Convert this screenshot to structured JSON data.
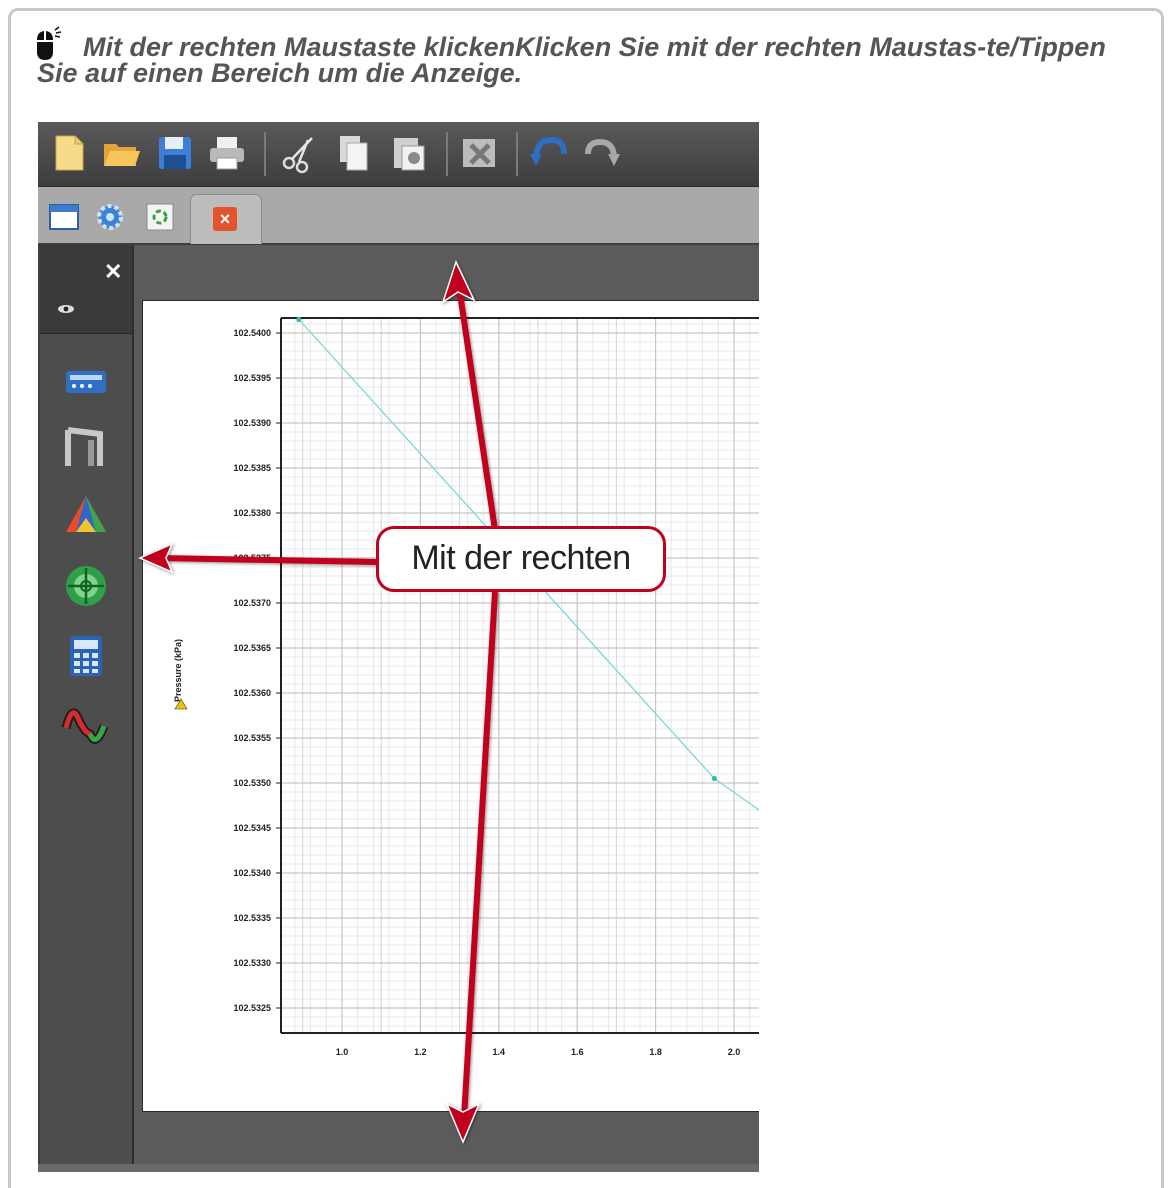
{
  "caption": {
    "text": "Mit der rechten Maustaste klickenKlicken Sie mit der rechten Maustas-te/Tippen Sie auf einen Bereich um die Anzeige.",
    "icon": "mouse-icon"
  },
  "toolbar": {
    "buttons": [
      "new-document-icon",
      "open-folder-icon",
      "save-icon",
      "print-icon",
      "cut-icon",
      "copy-icon",
      "paste-icon",
      "delete-icon",
      "undo-icon",
      "redo-icon"
    ]
  },
  "tabs": {
    "icons": [
      "window-icon",
      "gear-icon",
      "sync-icon"
    ],
    "active_close": "×"
  },
  "sidebar": {
    "close_label": "✕",
    "icons": [
      "device-icon",
      "bridge-icon",
      "triangle-prism-icon",
      "target-icon",
      "calculator-icon",
      "waveform-icon"
    ]
  },
  "chart_data": {
    "type": "line",
    "ylabel": "Pressure (kPa)",
    "xlabel": "",
    "x_ticks": [
      "1.0",
      "1.2",
      "1.4",
      "1.6",
      "1.8",
      "2.0"
    ],
    "y_ticks": [
      "102.5400",
      "102.5395",
      "102.5390",
      "102.5385",
      "102.5380",
      "102.5375",
      "102.5370",
      "102.5365",
      "102.5360",
      "102.5355",
      "102.5350",
      "102.5345",
      "102.5340",
      "102.5335",
      "102.5330",
      "102.5325"
    ],
    "xlim": [
      0.88,
      2.08
    ],
    "ylim": [
      102.5322,
      102.5403
    ],
    "series": [
      {
        "values_x": [
          0.89,
          1.95,
          2.08
        ],
        "values_y": [
          102.54015,
          102.53505,
          102.53465
        ],
        "markers": [
          0.89,
          1.95
        ],
        "color": "#7fd6d6"
      }
    ],
    "grid": true
  },
  "callout": {
    "text": "Mit der rechten"
  },
  "colors": {
    "callout_border": "#c0001d",
    "arrow": "#c0001d",
    "caption_text": "#555555"
  }
}
